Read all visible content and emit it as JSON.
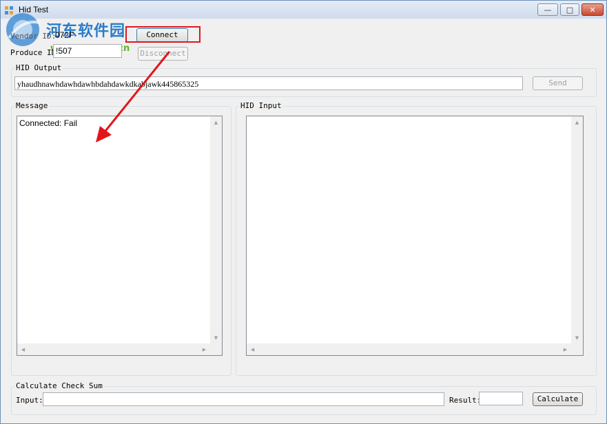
{
  "window": {
    "title": "Hid Test",
    "controls": {
      "minimize": "—",
      "maximize": "□",
      "close": "✕"
    }
  },
  "watermark": {
    "text": "河东软件园",
    "url": "www.pc0359.cn"
  },
  "device": {
    "vendor_label": "Vendor ID:",
    "vendor_value": "072F",
    "product_label": "Produce ID:",
    "product_value": "!507",
    "connect_label": "Connect",
    "disconnect_label": "Disconnect"
  },
  "hid_output": {
    "title": "HID Output",
    "value": "yhaudhnawhdawhdawhbdahdawkdkabjawk445865325",
    "send_label": "Send"
  },
  "message": {
    "title": "Message",
    "text": "Connected: Fail"
  },
  "hid_input": {
    "title": "HID Input",
    "text": ""
  },
  "checksum": {
    "title": "Calculate Check Sum",
    "input_label": "Input:",
    "input_value": "",
    "result_label": "Result:",
    "result_value": "",
    "calculate_label": "Calculate"
  },
  "scroll_arrows": {
    "up": "▲",
    "down": "▼",
    "left": "◀",
    "right": "▶"
  },
  "colors": {
    "annotation": "#e0161b",
    "titlebar": "#dbe6f3",
    "close": "#c74a32"
  }
}
